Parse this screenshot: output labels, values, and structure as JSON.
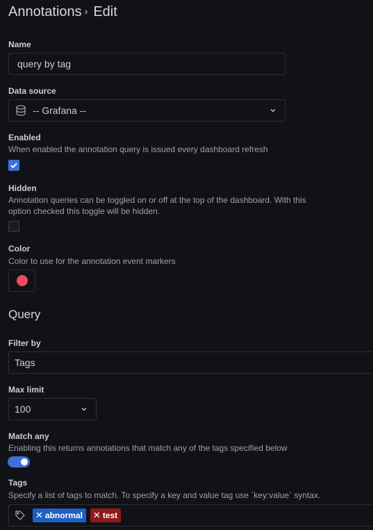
{
  "header": {
    "breadcrumb_parent": "Annotations",
    "separator": "›",
    "current": "Edit"
  },
  "name": {
    "label": "Name",
    "value": "query by tag"
  },
  "datasource": {
    "label": "Data source",
    "value": "-- Grafana --",
    "icon": "database-icon"
  },
  "enabled": {
    "label": "Enabled",
    "description": "When enabled the annotation query is issued every dashboard refresh",
    "checked": true
  },
  "hidden": {
    "label": "Hidden",
    "description_line1": "Annotation queries can be toggled on or off at the top of the dashboard. With this",
    "description_line2": "option checked this toggle will be hidden.",
    "checked": false
  },
  "color": {
    "label": "Color",
    "description": "Color to use for the annotation event markers",
    "value": "#f2495c"
  },
  "query": {
    "heading": "Query"
  },
  "filter_by": {
    "label": "Filter by",
    "value": "Tags"
  },
  "max_limit": {
    "label": "Max limit",
    "value": "100"
  },
  "match_any": {
    "label": "Match any",
    "description": "Enabling this returns annotations that match any of the tags specified below",
    "on": true
  },
  "tags": {
    "label": "Tags",
    "description": "Specify a list of tags to match. To specify a key and value tag use `key:value` syntax.",
    "items": [
      {
        "text": "abnormal",
        "color": "#1f60c4"
      },
      {
        "text": "test",
        "color": "#8f1a1a"
      }
    ]
  }
}
